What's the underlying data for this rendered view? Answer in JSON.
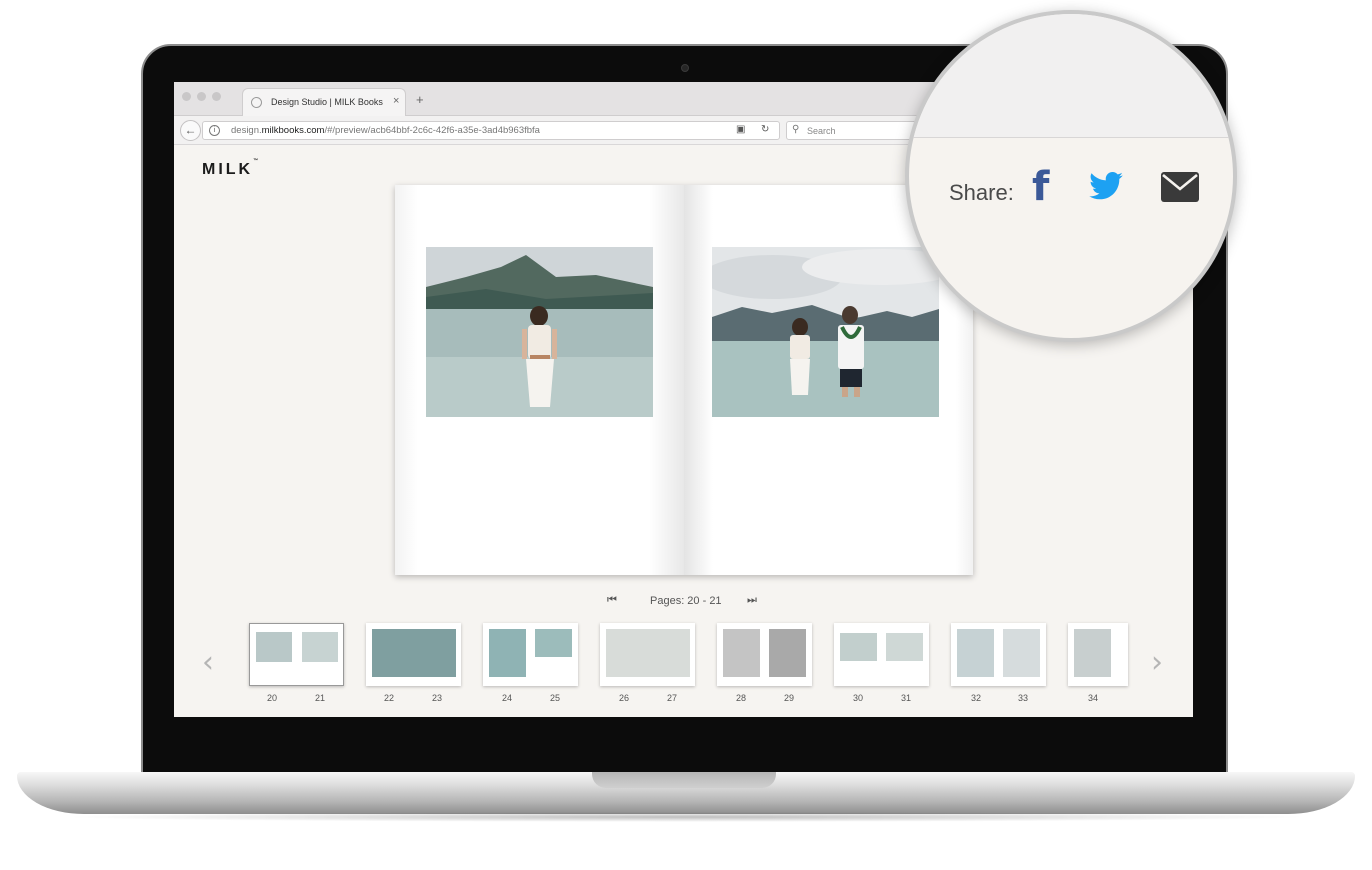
{
  "browser": {
    "tab_title": "Design Studio | MILK Books",
    "tab_close": "×",
    "new_tab": "+",
    "url_prefix": "design.",
    "url_domain": "milkbooks.com",
    "url_path": "/#/preview/acb64bbf-2c6c-42f6-a35e-3ad4b963fbfa",
    "search_placeholder": "Search"
  },
  "site": {
    "logo": "MILK",
    "logo_tm": "™"
  },
  "pager": {
    "label": "Pages: 20 - 21",
    "first_icon": "⏮",
    "last_icon": "⏭"
  },
  "thumbnails": {
    "prev_icon": "‹",
    "next_icon": "›",
    "items": [
      {
        "left": "20",
        "right": "21",
        "selected": true
      },
      {
        "left": "22",
        "right": "23",
        "selected": false
      },
      {
        "left": "24",
        "right": "25",
        "selected": false
      },
      {
        "left": "26",
        "right": "27",
        "selected": false
      },
      {
        "left": "28",
        "right": "29",
        "selected": false
      },
      {
        "left": "30",
        "right": "31",
        "selected": false
      },
      {
        "left": "32",
        "right": "33",
        "selected": false
      },
      {
        "left": "34",
        "right": "",
        "selected": false
      }
    ]
  },
  "share": {
    "label": "Share:",
    "facebook_glyph": "f",
    "icons": [
      "facebook-icon",
      "twitter-icon",
      "email-icon"
    ],
    "colors": {
      "facebook": "#3b5998",
      "twitter": "#1da1f2",
      "email": "#3a3a3a"
    }
  }
}
